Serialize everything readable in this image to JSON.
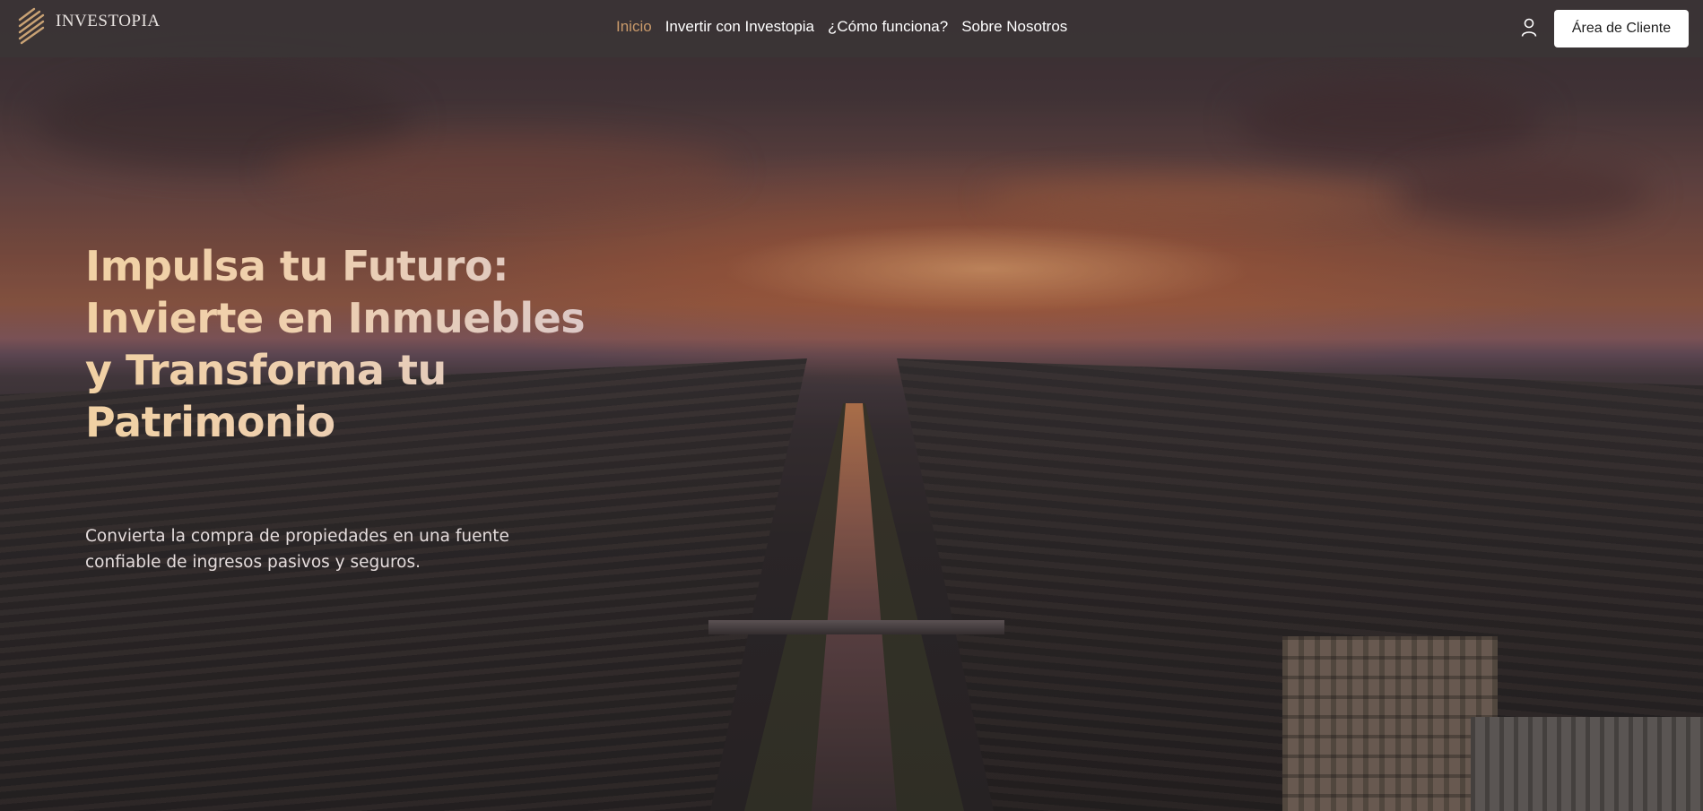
{
  "brand": {
    "name": "INVESTOPIA",
    "logo_icon": "stacked-stripes-logo-icon",
    "logo_color": "#c9a274"
  },
  "nav": {
    "items": [
      {
        "label": "Inicio",
        "active": true
      },
      {
        "label": "Invertir con Investopia",
        "active": false
      },
      {
        "label": "¿Cómo funciona?",
        "active": false
      },
      {
        "label": "Sobre Nosotros",
        "active": false
      }
    ],
    "active_color": "#c99a6a",
    "user_icon": "user-icon",
    "client_button_label": "Área de Cliente"
  },
  "hero": {
    "title": "Impulsa tu Futuro: Invierte en Inmuebles y Transforma tu Patrimonio",
    "subtitle": "Convierta la compra de propiedades en una fuente confiable de ingresos pasivos y seguros.",
    "title_color": "#f1d1a4",
    "background": "aerial sunset canal city photo"
  }
}
